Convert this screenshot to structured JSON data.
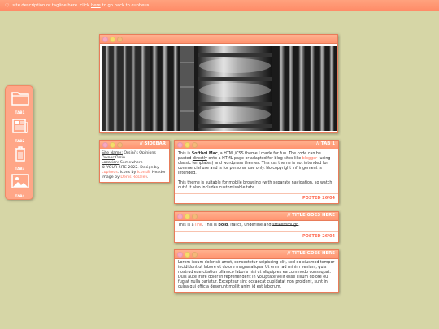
{
  "topbar": {
    "text_before": "site description or tagline here. click",
    "link": "here",
    "text_after": "to go back to cupheus."
  },
  "sidebar_nav": [
    {
      "icon": "folder-icon",
      "label": "TAB1"
    },
    {
      "icon": "newspaper-icon",
      "label": "TAB2"
    },
    {
      "icon": "trash-icon",
      "label": "TAB3"
    },
    {
      "icon": "image-icon",
      "label": "TAB4"
    }
  ],
  "sidebar_window": {
    "title": "// SIDEBAR",
    "site_name_label": "Site Name:",
    "site_name": "Orsini's Opinions",
    "owner_label": "Owner:",
    "owner": "Orsin",
    "location_label": "Location:",
    "location": "Somewhere",
    "copyright": "© YOUR SITE 2022. Design by",
    "designer": "cupheus",
    "icons_by_pre": ". Icons by",
    "icons_by": "Icons8",
    "header_pre": ". Header image by",
    "header_by": "Denis Rosalev",
    "end": "."
  },
  "tab_window": {
    "title": "// TAB 1",
    "p1_a": "This is",
    "p1_bold": "Softboi Mac",
    "p1_b": ", a HTML/CSS theme I made for fun. The code can be pasted",
    "p1_u": "directly",
    "p1_c": "onto a HTML page or adapted for blog sites like",
    "p1_link": "blogger",
    "p1_d": "(using classic templates) and wordpress themes. This css theme is not intended for commercial use and is for personal use only. No copyright infringement is intended.",
    "p2": "This theme is suitable for mobile browsing (with separate navigation, so watch out)! It also includes customisable tabs.",
    "posted": "POSTED 26/04"
  },
  "title_window": {
    "title": "// TITLE GOES HERE",
    "a": "This is a",
    "link": "link",
    "b": ". This is",
    "bold": "bold",
    "c": ", italics,",
    "underline": "underline",
    "d": "and",
    "strike": "strikethrough",
    "e": ".",
    "posted": "POSTED 26/04"
  },
  "lorem_window": {
    "title": "// TITLE GOES HERE",
    "text": "Lorem ipsum dolor sit amet, consectetur adipiscing elit, sed do eiusmod tempor incididunt ut labore et dolore magna aliqua. Ut enim ad minim veniam, quis nostrud exercitation ullamco laboris nisi ut aliquip ex ea commodo consequat. Duis aute irure dolor in reprehenderit in voluptate velit esse cillum dolore eu fugiat nulla pariatur. Excepteur sint occaecat cupidatat non proident, sunt in culpa qui officia deserunt mollit anim id est laborum."
  },
  "colors": {
    "background": "#d6d6a6",
    "accent": "#ff9470",
    "link": "#ff6d54"
  }
}
